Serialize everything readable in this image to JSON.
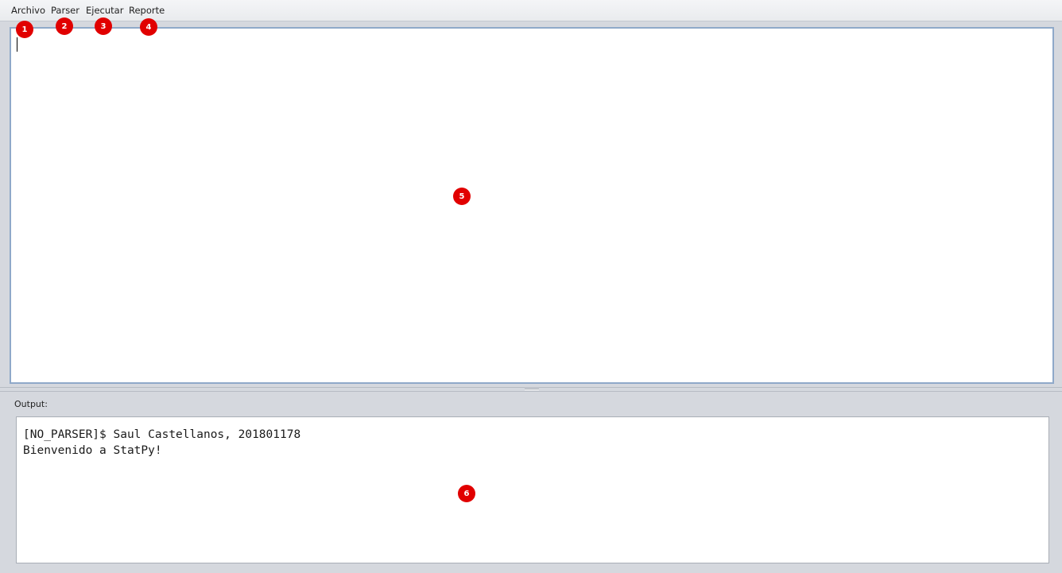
{
  "menubar": {
    "items": [
      {
        "label": "Archivo"
      },
      {
        "label": "Parser"
      },
      {
        "label": "Ejecutar"
      },
      {
        "label": "Reporte"
      }
    ]
  },
  "output": {
    "label": "Output:",
    "lines": [
      "[NO_PARSER]$ Saul Castellanos, 201801178",
      "Bienvenido a StatPy!"
    ]
  },
  "annotations": [
    "1",
    "2",
    "3",
    "4",
    "5",
    "6"
  ],
  "colors": {
    "badge": "#e10000",
    "editor_border": "#8fa9c9",
    "background": "#d5d8de"
  }
}
